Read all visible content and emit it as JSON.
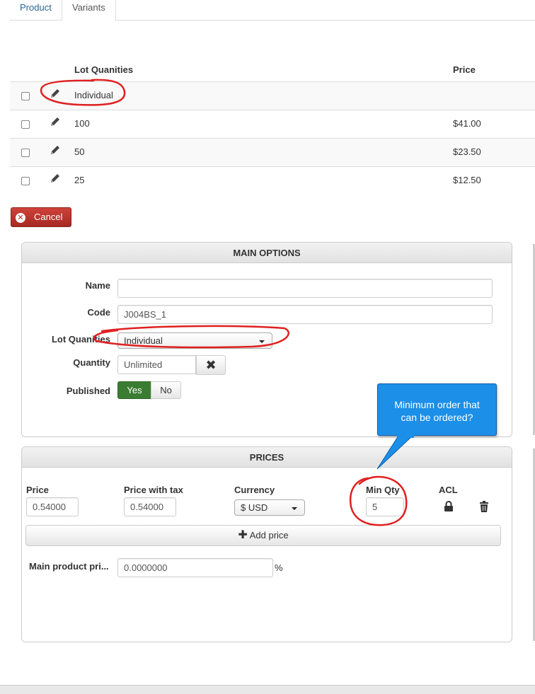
{
  "tabs": [
    {
      "label": "Product"
    },
    {
      "label": "Variants"
    }
  ],
  "variants_table": {
    "headers": {
      "lot_quantities": "Lot Quanities",
      "price": "Price"
    },
    "rows": [
      {
        "qty": "Individual",
        "price": ""
      },
      {
        "qty": "100",
        "price": "$41.00"
      },
      {
        "qty": "50",
        "price": "$23.50"
      },
      {
        "qty": "25",
        "price": "$12.50"
      }
    ]
  },
  "cancel_label": "Cancel",
  "main_options": {
    "title": "MAIN OPTIONS",
    "name_label": "Name",
    "name_value": "",
    "code_label": "Code",
    "code_value": "J004BS_1",
    "lot_label": "Lot Quanities",
    "lot_value": "Individual",
    "quantity_label": "Quantity",
    "quantity_value": "Unlimited",
    "published_label": "Published",
    "yes_label": "Yes",
    "no_label": "No"
  },
  "prices": {
    "title": "PRICES",
    "headers": {
      "price": "Price",
      "price_with_tax": "Price with tax",
      "currency": "Currency",
      "min_qty": "Min Qty",
      "acl": "ACL"
    },
    "row": {
      "price": "0.54000",
      "price_with_tax": "0.54000",
      "currency": "$ USD",
      "min_qty": "5"
    },
    "add_label": "Add price",
    "main_product_label": "Main product pri...",
    "main_product_value": "0.0000000",
    "percent": "%"
  },
  "callout": {
    "line1": "Minimum order that",
    "line2": "can be ordered?"
  },
  "colors": {
    "annotation": "#e02020",
    "callout": "#1c8fe8",
    "cancel": "#b3332c",
    "published_yes": "#3a7d32"
  }
}
